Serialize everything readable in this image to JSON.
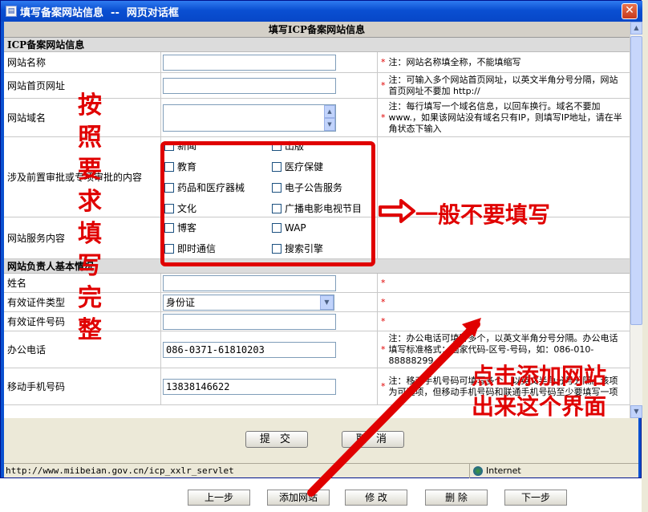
{
  "window": {
    "title": "填写备案网站信息  --  网页对话框",
    "close_glyph": "✕",
    "app_icon": "doc-icon"
  },
  "form": {
    "header": "填写ICP备案网站信息",
    "section1": "ICP备案网站信息",
    "section2": "网站负责人基本情况",
    "rows": {
      "site_name": {
        "label": "网站名称",
        "note": "注：网站名称填全称，不能填缩写"
      },
      "site_url": {
        "label": "网站首页网址",
        "note": "注：可输入多个网站首页网址，以英文半角分号分隔，网站首页网址不要加 http://"
      },
      "site_domain": {
        "label": "网站域名",
        "note": "注：每行填写一个域名信息，以回车换行。域名不要加 www.，如果该网站没有域名只有IP，则填写IP地址，请在半角状态下输入"
      },
      "prereq": {
        "label": "涉及前置审批或专项审批的内容",
        "options": [
          "新闻",
          "出版",
          "教育",
          "医疗保健",
          "药品和医疗器械",
          "电子公告服务",
          "文化",
          "广播电影电视节目"
        ]
      },
      "service": {
        "label": "网站服务内容",
        "options": [
          "博客",
          "WAP",
          "即时通信",
          "搜索引擎"
        ]
      },
      "name": {
        "label": "姓名",
        "note": ""
      },
      "id_type": {
        "label": "有效证件类型",
        "value": "身份证",
        "note": ""
      },
      "id_number": {
        "label": "有效证件号码",
        "note": ""
      },
      "office_phone": {
        "label": "办公电话",
        "value": "086-0371-61810203",
        "note": "注：办公电话可填写多个，以英文半角分号分隔。办公电话填写标准格式：国家代码-区号-号码，如：086-010-88888299"
      },
      "mobile": {
        "label": "移动手机号码",
        "value": "13838146622",
        "note": "注：移动手机号码可填写多个，以英文半角分号分隔。该项为可选项，但移动手机号码和联通手机号码至少要填写一项"
      }
    },
    "required_mark": "*"
  },
  "dialog_buttons": {
    "submit": "提 交",
    "cancel": "取 消"
  },
  "status_bar": {
    "url": "http://www.miibeian.gov.cn/icp_xxlr_servlet",
    "zone": "Internet"
  },
  "page_buttons": {
    "prev": "上一步",
    "add_site": "添加网站",
    "modify": "修 改",
    "delete": "删 除",
    "next": "下一步"
  },
  "annotations": {
    "vertical": "按照要求填写完整",
    "not_needed": "一般不要填写",
    "click_add": [
      "点击添加网站",
      "出来这个界面"
    ],
    "color": "#e00000"
  }
}
